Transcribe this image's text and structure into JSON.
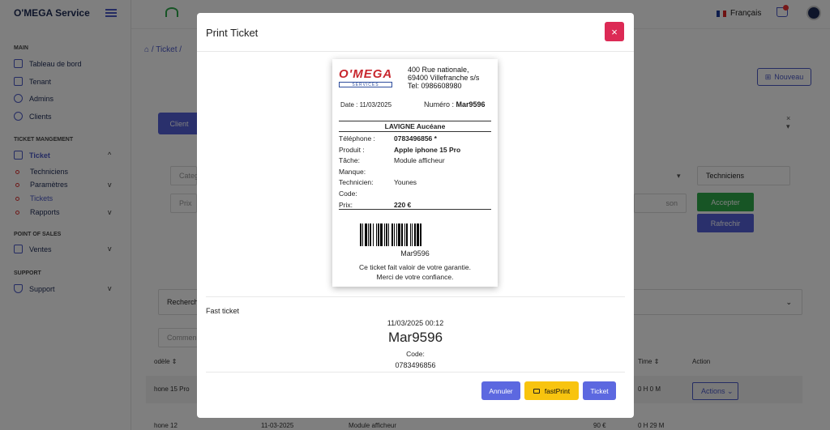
{
  "app": {
    "brand": "O'MEGA Service"
  },
  "sidebar": {
    "sections": {
      "main": "MAIN",
      "ticket": "TICKET MANGEMENT",
      "pos": "POINT OF SALES",
      "support": "SUPPORT"
    },
    "items": {
      "dashboard": "Tableau de bord",
      "tenant": "Tenant",
      "admins": "Admins",
      "clients": "Clients",
      "ticket": "Ticket",
      "techniciens": "Techniciens",
      "parametres": "Paramètres",
      "tickets": "Tickets",
      "rapports": "Rapports",
      "ventes": "Ventes",
      "support": "Support"
    }
  },
  "topbar": {
    "language": "Français"
  },
  "page": {
    "breadcrumb": "Ticket",
    "nouveau": "Nouveau",
    "client_btn": "Client",
    "categorie": "Catego",
    "prix": "Prix",
    "techniciens_field": "Techniciens",
    "reason_field": "son",
    "accepter": "Accepter",
    "rafrechir": "Rafrechir",
    "recherche": "Recherch",
    "comment": "Commen",
    "headers": {
      "modele": "odèle",
      "time": "Time",
      "action": "Action"
    },
    "rows": [
      {
        "model": "hone 15 Pro",
        "time": "0 H 0 M",
        "action": "Actions"
      },
      {
        "model": "hone 12",
        "date": "11-03-2025",
        "task": "Module afficheur",
        "price": "90 €",
        "time": "0 H 29 M"
      }
    ]
  },
  "modal": {
    "title": "Print Ticket",
    "close_icon": "×",
    "ticket": {
      "logo_text": "O'MEGA",
      "logo_sub": "SERVICES",
      "address": [
        "400 Rue nationale,",
        "69400 Villefranche s/s",
        "Tel: 0986608980"
      ],
      "date_label": "Date : 11/03/2025",
      "numero_label": "Numéro : ",
      "numero": "Mar9596",
      "customer": "LAVIGNE Aucéane",
      "rows": [
        {
          "k": "Téléphone :",
          "v": "0783496856 *",
          "bold": true
        },
        {
          "k": "Produit :",
          "v": "Apple iphone 15 Pro",
          "bold": true
        },
        {
          "k": "Tâche:",
          "v": "Module afficheur",
          "bold": false
        },
        {
          "k": "Manque:",
          "v": "",
          "bold": false
        },
        {
          "k": "Technicien:",
          "v": "Younes",
          "bold": false
        },
        {
          "k": "Code:",
          "v": "",
          "bold": false
        },
        {
          "k": "Prix:",
          "v": "220 €",
          "bold": true
        }
      ],
      "barcode_text": "Mar9596",
      "footer1": "Ce ticket fait valoir de votre garantie.",
      "footer2": "Merci de votre confiance."
    },
    "fast": {
      "label": "Fast ticket",
      "datetime": "11/03/2025 00:12",
      "number": "Mar9596",
      "code_label": "Code:",
      "phone": "0783496856"
    },
    "buttons": {
      "annuler": "Annuler",
      "fastprint": "fastPrint",
      "ticket": "Ticket"
    }
  }
}
